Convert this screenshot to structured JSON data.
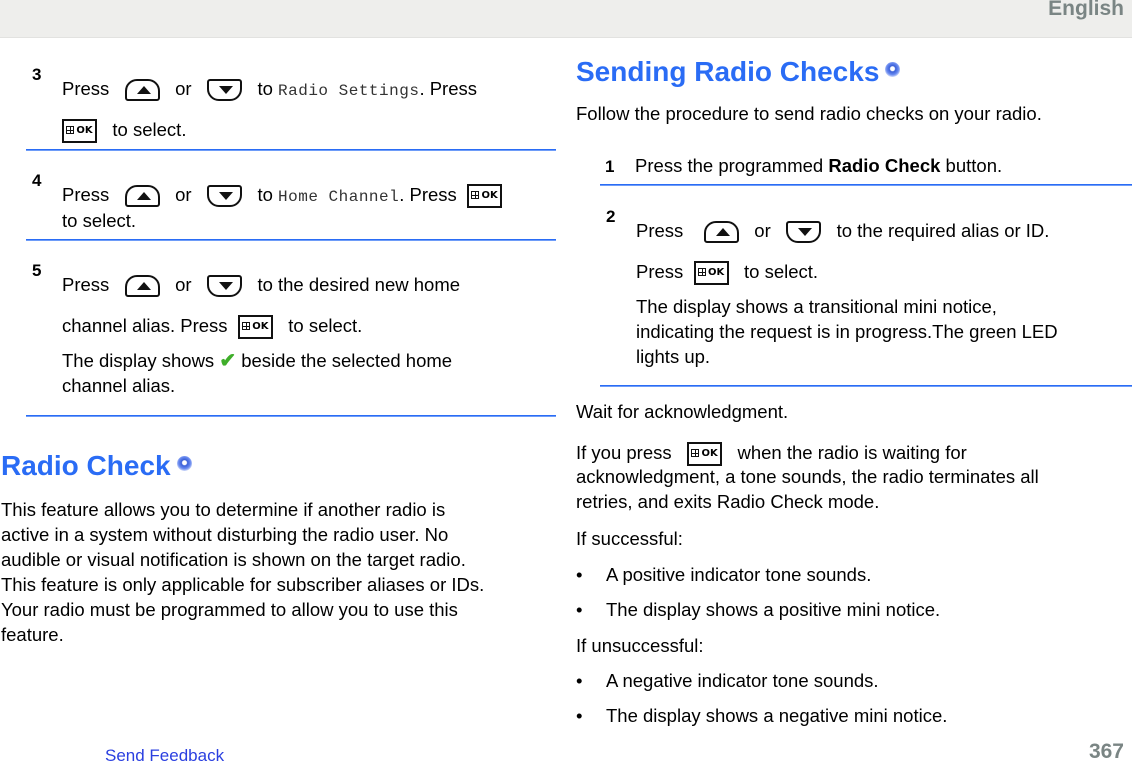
{
  "header": {
    "language": "English"
  },
  "left": {
    "steps": [
      {
        "number": "3",
        "line1": {
          "press": "Press",
          "or": "or",
          "to": "to",
          "target": "Radio Settings",
          "after": ". Press"
        },
        "line2": {
          "after": "to select."
        }
      },
      {
        "number": "4",
        "line1": {
          "press": "Press",
          "or": "or",
          "to": "to",
          "target": "Home Channel",
          "after": ". Press"
        },
        "line2": {
          "text": "to select."
        }
      },
      {
        "number": "5",
        "line1": {
          "press": "Press",
          "or": "or",
          "after": "to the desired new home"
        },
        "line2": {
          "before": "channel alias. Press",
          "after": "to select."
        },
        "line3": {
          "before": "The display shows",
          "after": "beside the selected home"
        },
        "line4": {
          "text": "channel alias."
        }
      }
    ],
    "section": {
      "title": "Radio Check",
      "paragraph_lines": [
        "This feature allows you to determine if another radio is",
        "active in a system without disturbing the radio user. No",
        "audible or visual notification is shown on the target radio.",
        "This feature is only applicable for subscriber aliases or IDs.",
        "Your radio must be programmed to allow you to use this",
        "feature."
      ]
    }
  },
  "right": {
    "title": "Sending Radio Checks",
    "intro": "Follow the procedure to send radio checks on your radio.",
    "steps": [
      {
        "number": "1",
        "before": "Press the programmed ",
        "bold": "Radio Check",
        "after": " button."
      },
      {
        "number": "2",
        "line1": {
          "press": "Press",
          "or": "or",
          "after": "to the required alias or ID."
        },
        "line2": {
          "press": "Press",
          "after": "to select."
        },
        "result_lines": [
          "The display shows a transitional mini notice,",
          "indicating the request is in progress.The green LED",
          "lights up."
        ]
      }
    ],
    "wait": "Wait for acknowledgment.",
    "cancel": {
      "before": "If you press",
      "after": "when the radio is waiting for",
      "line2": "acknowledgment, a tone sounds, the radio terminates all",
      "line3": "retries, and exits Radio Check mode."
    },
    "success_label": "If successful:",
    "success_bullets": [
      "A positive indicator tone sounds.",
      "The display shows a positive mini notice."
    ],
    "fail_label": "If unsuccessful:",
    "fail_bullets": [
      "A negative indicator tone sounds.",
      "The display shows a negative mini notice."
    ]
  },
  "footer": {
    "feedback_link": "Send Feedback",
    "page_number": "367"
  },
  "icons": {
    "up": "up-arrow-key-icon",
    "down": "down-arrow-key-icon",
    "ok": "menu-ok-key-icon",
    "check": "checkmark-icon",
    "globe": "globe-icon",
    "ok_label": "OK",
    "check_glyph": "✔",
    "bullet": "•"
  },
  "colors": {
    "accent_blue": "#2a6cf5",
    "link_blue": "#2a3fe0",
    "header_gray": "#7a8584",
    "topbar_bg": "#eeeeec",
    "check_green": "#3fae2a"
  }
}
